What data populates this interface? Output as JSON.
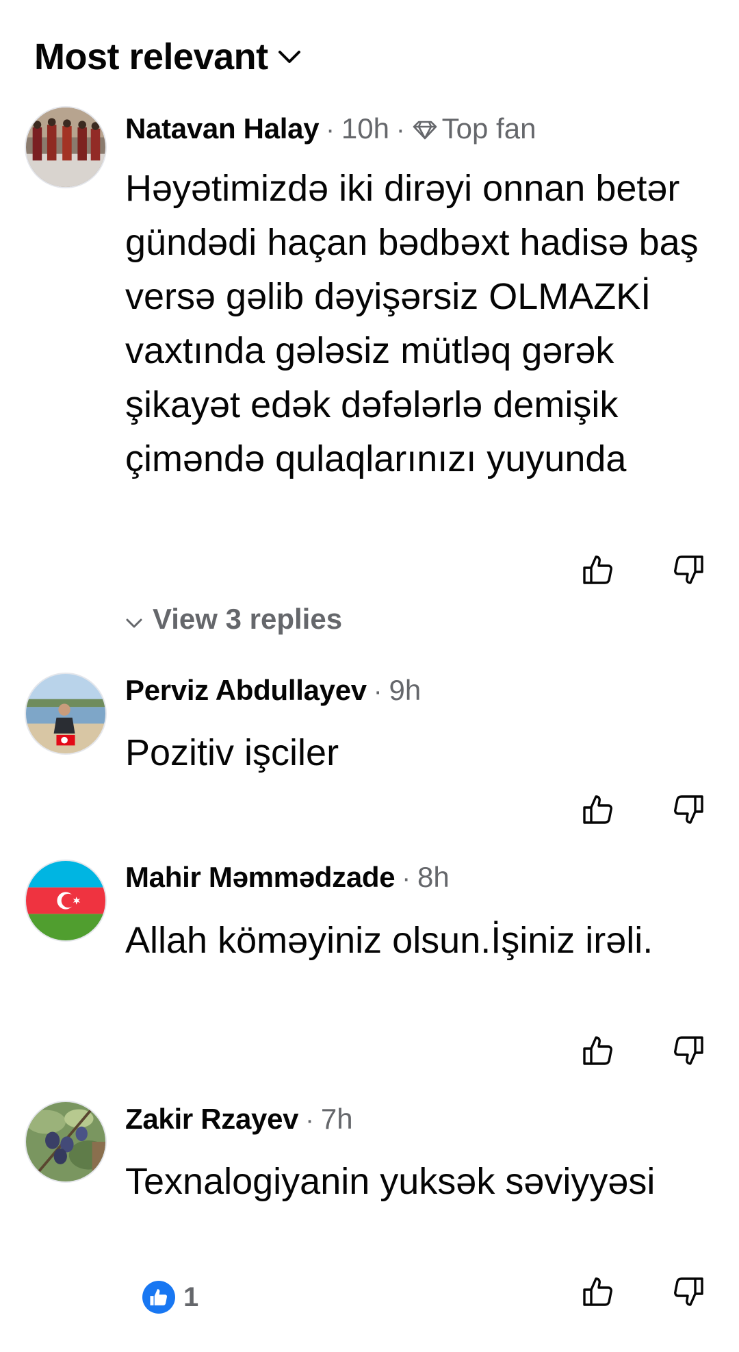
{
  "header": {
    "sort_label": "Most relevant"
  },
  "comments": [
    {
      "author": "Natavan Halay",
      "time": "10h",
      "badge": "Top fan",
      "text": "Həyətimizdə iki dirəyi onnan betər gündədi haçan bədbəxt hadisə baş versə gəlib dəyişərsiz OLMAZKİ vaxtında gələsiz mütləq gərək şikayət edək dəfələrlə demişik çiməndə qulaqlarınızı yuyunda",
      "replies_label": "View 3 replies"
    },
    {
      "author": "Perviz Abdullayev",
      "time": "9h",
      "text": "Pozitiv işciler"
    },
    {
      "author": "Mahir Məmmədzade",
      "time": "8h",
      "text": "Allah köməyiniz olsun.İşiniz irəli."
    },
    {
      "author": "Zakir Rzayev",
      "time": "7h",
      "text": "Texnalogiyanin yuksək səviyyəsi",
      "reaction_count": "1"
    }
  ],
  "colors": {
    "secondary_text": "#65676b",
    "primary_text": "#050505",
    "like_blue": "#1877f2"
  },
  "icons": {
    "sort": "chevron-down-icon",
    "badge": "diamond-icon",
    "like": "thumbs-up-icon",
    "dislike": "thumbs-down-icon",
    "replies": "chevron-down-icon"
  }
}
